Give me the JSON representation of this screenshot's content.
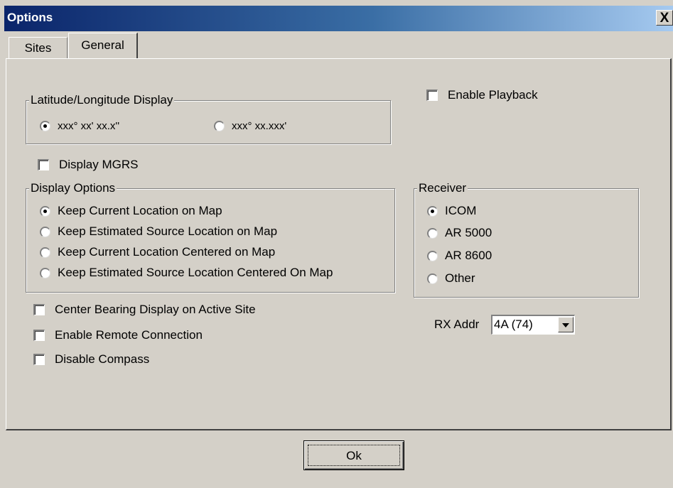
{
  "window": {
    "title": "Options",
    "close_label": "X"
  },
  "tabs": [
    {
      "label": "Sites"
    },
    {
      "label": "General"
    }
  ],
  "latlon_group": {
    "legend": "Latitude/Longitude Display",
    "options": [
      {
        "label": "xxx° xx' xx.x''",
        "checked": true
      },
      {
        "label": "xxx° xx.xxx'",
        "checked": false
      }
    ]
  },
  "display_mgrs": {
    "label": "Display MGRS",
    "checked": false
  },
  "display_options_group": {
    "legend": "Display Options",
    "options": [
      {
        "label": "Keep Current Location on Map",
        "checked": true
      },
      {
        "label": "Keep Estimated Source Location on Map",
        "checked": false
      },
      {
        "label": "Keep Current Location Centered on Map",
        "checked": false
      },
      {
        "label": "Keep Estimated Source Location Centered On Map",
        "checked": false
      }
    ]
  },
  "checkboxes": [
    {
      "label": "Center Bearing Display on Active Site",
      "checked": false
    },
    {
      "label": "Enable Remote Connection",
      "checked": false
    },
    {
      "label": "Disable Compass",
      "checked": false
    }
  ],
  "enable_playback": {
    "label": "Enable Playback",
    "checked": false
  },
  "receiver_group": {
    "legend": "Receiver",
    "options": [
      {
        "label": "ICOM",
        "checked": true
      },
      {
        "label": "AR 5000",
        "checked": false
      },
      {
        "label": "AR 8600",
        "checked": false
      },
      {
        "label": "Other",
        "checked": false
      }
    ]
  },
  "rx_addr": {
    "label": "RX Addr",
    "value": "4A (74)"
  },
  "ok_button": {
    "label": "Ok"
  }
}
